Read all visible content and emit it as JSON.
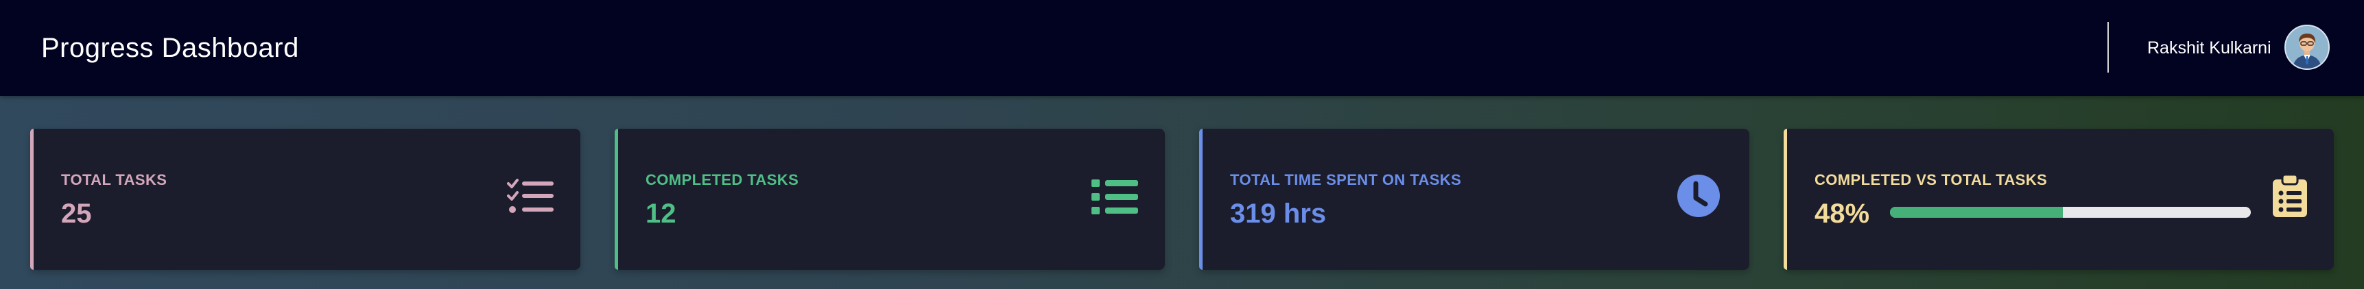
{
  "header": {
    "title": "Progress Dashboard",
    "user_name": "Rakshit Kulkarni",
    "avatar_icon": "user-avatar-icon"
  },
  "cards": [
    {
      "label": "TOTAL TASKS",
      "value": "25",
      "color": "#d4a6ba",
      "icon": "task-checklist-icon"
    },
    {
      "label": "COMPLETED TASKS",
      "value": "12",
      "color": "#4fbf86",
      "icon": "list-icon"
    },
    {
      "label": "TOTAL TIME SPENT ON TASKS",
      "value": "319 hrs",
      "color": "#6b8ee8",
      "icon": "clock-icon"
    },
    {
      "label": "COMPLETED VS TOTAL TASKS",
      "value": "48%",
      "color": "#f3dc9b",
      "icon": "clipboard-icon",
      "progress": 0.48,
      "progress_color": "#46b079"
    }
  ]
}
